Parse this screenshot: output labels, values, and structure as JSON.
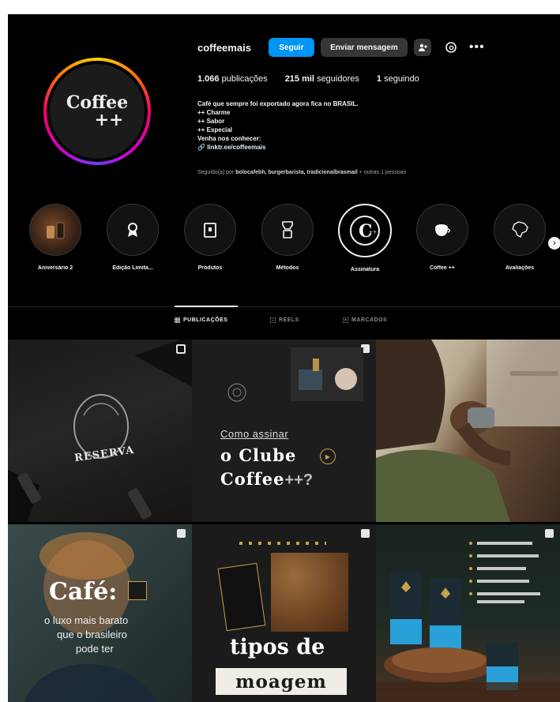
{
  "profile": {
    "username": "coffeemais",
    "follow_label": "Seguir",
    "message_label": "Enviar mensagem",
    "logo_line1": "Coffee",
    "logo_line2": "++",
    "stats": {
      "posts": "1.066",
      "posts_label": "publicações",
      "followers": "215 mil",
      "followers_label": "seguidores",
      "following": "1",
      "following_label": "seguindo"
    },
    "bio": {
      "line1": "Café que sempre foi exportado agora fica no BRASIL.",
      "line2": "++ Charme",
      "line3": "++ Sabor",
      "line4": "++ Especial",
      "line5": "Venha nos conhecer:",
      "link": "linktr.ee/coffeemais"
    },
    "followed_by_prefix": "Seguido(a) por",
    "followed_by_names": "bolocafebh, burgerbarista, tradicionalbrasmail",
    "followed_by_suffix": "+ outras 1 pessoas"
  },
  "highlights": [
    {
      "label": "Aniversário 2"
    },
    {
      "label": "Edição Limita..."
    },
    {
      "label": "Produtos"
    },
    {
      "label": "Métodos"
    },
    {
      "label": "Assinatura"
    },
    {
      "label": "Coffee ++"
    },
    {
      "label": "Avaliações"
    }
  ],
  "tabs": [
    {
      "label": "PUBLICAÇÕES"
    },
    {
      "label": "REELS"
    },
    {
      "label": "MARCADOS"
    }
  ],
  "posts": {
    "p1_text": "RESERVA",
    "p2_line1": "Como assinar",
    "p2_line2": "o Clube",
    "p2_line3": "Coffee",
    "p2_line3_suffix": "++?",
    "p4_title": "Café:",
    "p4_line1": "o luxo mais barato",
    "p4_line2": "que o brasileiro",
    "p4_line3": "pode ter",
    "p5_line1": "tipos de",
    "p5_line2": "moagem"
  },
  "colors": {
    "background": "#000000",
    "accent": "#0095f6",
    "button": "#363636"
  }
}
